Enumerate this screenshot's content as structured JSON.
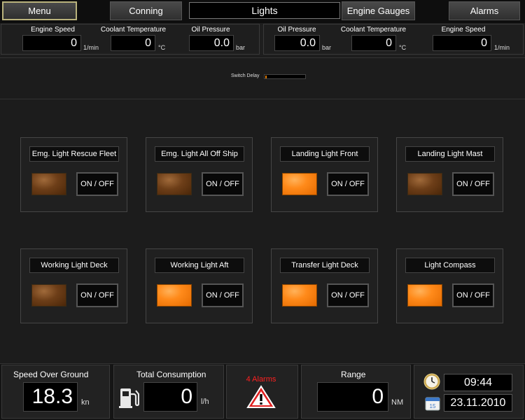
{
  "nav": {
    "menu": "Menu",
    "conning": "Conning",
    "title": "Lights",
    "engine_gauges": "Engine Gauges",
    "alarms": "Alarms"
  },
  "engine_left": {
    "speed_label": "Engine Speed",
    "speed_value": "0",
    "speed_unit": "1/min",
    "coolant_label": "Coolant Temperature",
    "coolant_value": "0",
    "coolant_unit": "°C",
    "oil_label": "Oil Pressure",
    "oil_value": "0.0",
    "oil_unit": "bar"
  },
  "engine_right": {
    "oil_label": "Oil Pressure",
    "oil_value": "0.0",
    "oil_unit": "bar",
    "coolant_label": "Coolant Temperature",
    "coolant_value": "0",
    "coolant_unit": "°C",
    "speed_label": "Engine Speed",
    "speed_value": "0",
    "speed_unit": "1/min"
  },
  "switch_delay": {
    "label": "Switch Delay",
    "level": 0.03
  },
  "lights": [
    {
      "name": "Emg. Light Rescue Fleet",
      "state": "off",
      "button": "ON / OFF"
    },
    {
      "name": "Emg. Light All Off Ship",
      "state": "off",
      "button": "ON / OFF"
    },
    {
      "name": "Landing Light Front",
      "state": "on",
      "button": "ON / OFF"
    },
    {
      "name": "Landing Light Mast",
      "state": "off",
      "button": "ON / OFF"
    },
    {
      "name": "Working Light Deck",
      "state": "off",
      "button": "ON / OFF"
    },
    {
      "name": "Working Light Aft",
      "state": "on",
      "button": "ON / OFF"
    },
    {
      "name": "Transfer Light Deck",
      "state": "on",
      "button": "ON / OFF"
    },
    {
      "name": "Light Compass",
      "state": "on",
      "button": "ON / OFF"
    }
  ],
  "bottom": {
    "sog_label": "Speed Over Ground",
    "sog_value": "18.3",
    "sog_unit": "kn",
    "consumption_label": "Total Consumption",
    "consumption_value": "0",
    "consumption_unit": "l/h",
    "alarm_count": "4 Alarms",
    "range_label": "Range",
    "range_value": "0",
    "range_unit": "NM",
    "time": "09:44",
    "date": "23.11.2010",
    "calendar_day": "15"
  },
  "colors": {
    "lamp_on": "#ff8a1a",
    "lamp_off": "#6d3e18",
    "alarm_red": "#ff2020"
  },
  "icons": [
    "fuel-pump-icon",
    "warning-triangle-icon",
    "clock-icon",
    "calendar-icon"
  ]
}
